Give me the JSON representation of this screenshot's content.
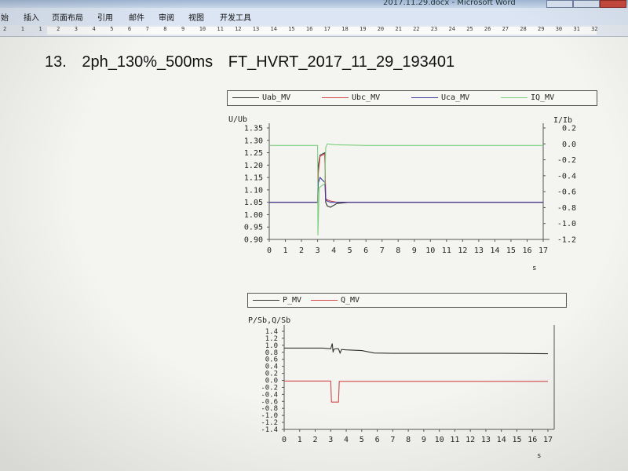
{
  "window": {
    "title": "2017.11.29.docx - Microsoft Word"
  },
  "ribbon": {
    "tabs": [
      "始",
      "插入",
      "页面布局",
      "引用",
      "邮件",
      "审阅",
      "视图",
      "开发工具"
    ]
  },
  "ruler": {
    "numbers": [
      "2",
      "1",
      "1",
      "2",
      "3",
      "4",
      "5",
      "6",
      "7",
      "8",
      "9",
      "10",
      "11",
      "12",
      "13",
      "14",
      "15",
      "16",
      "17",
      "18",
      "19",
      "20",
      "21",
      "22",
      "23",
      "24",
      "25",
      "26",
      "27",
      "28",
      "29",
      "30",
      "31",
      "32"
    ]
  },
  "document": {
    "heading": {
      "number": "13.",
      "case": "2ph_130%_500ms",
      "file": "FT_HVRT_2017_11_29_193401"
    }
  },
  "colors": {
    "uab": "#333333",
    "ubc": "#d04848",
    "uca": "#3a3aa0",
    "iq": "#7ccf7c",
    "p": "#333333",
    "q": "#d04848"
  },
  "chart_data": [
    {
      "type": "line",
      "legend": [
        "Uab_MV",
        "Ubc_MV",
        "Uca_MV",
        "IQ_MV"
      ],
      "ylabel": "U/Ub",
      "ylabel_right": "I/Ib",
      "xlabel": "s",
      "xlim": [
        0,
        17
      ],
      "ylim": [
        0.9,
        1.35
      ],
      "ylim_right": [
        -1.2,
        0.2
      ],
      "x_ticks": [
        "0",
        "1",
        "2",
        "3",
        "4",
        "5",
        "6",
        "7",
        "8",
        "9",
        "10",
        "11",
        "12",
        "13",
        "14",
        "15",
        "16",
        "17"
      ],
      "y_ticks": [
        "1.35",
        "1.30",
        "1.25",
        "1.20",
        "1.15",
        "1.10",
        "1.05",
        "1.00",
        "0.95",
        "0.90"
      ],
      "y_ticks_right": [
        "0.2",
        "0.0",
        "-0.2",
        "-0.4",
        "-0.6",
        "-0.8",
        "-1.0",
        "-1.2"
      ],
      "series": [
        {
          "name": "Uab_MV",
          "axis": "left",
          "x": [
            0,
            3.0,
            3.05,
            3.15,
            3.3,
            3.45,
            3.5,
            3.6,
            3.8,
            4.2,
            5,
            6,
            8,
            10,
            12,
            14,
            17
          ],
          "y": [
            1.05,
            1.05,
            1.2,
            1.24,
            1.245,
            1.25,
            1.05,
            1.035,
            1.03,
            1.045,
            1.05,
            1.05,
            1.05,
            1.05,
            1.05,
            1.05,
            1.05
          ]
        },
        {
          "name": "Ubc_MV",
          "axis": "left",
          "x": [
            0,
            3.0,
            3.05,
            3.15,
            3.3,
            3.45,
            3.5,
            3.6,
            3.8,
            4.2,
            5,
            6,
            8,
            10,
            12,
            14,
            17
          ],
          "y": [
            1.05,
            1.05,
            1.17,
            1.235,
            1.24,
            1.245,
            1.065,
            1.06,
            1.055,
            1.05,
            1.05,
            1.05,
            1.05,
            1.05,
            1.05,
            1.05,
            1.05
          ]
        },
        {
          "name": "Uca_MV",
          "axis": "left",
          "x": [
            0,
            3.0,
            3.05,
            3.15,
            3.3,
            3.45,
            3.5,
            3.6,
            3.8,
            4.2,
            5,
            6,
            8,
            10,
            12,
            14,
            17
          ],
          "y": [
            1.05,
            1.05,
            1.13,
            1.15,
            1.14,
            1.13,
            1.06,
            1.055,
            1.05,
            1.05,
            1.05,
            1.05,
            1.05,
            1.05,
            1.05,
            1.05,
            1.05
          ]
        },
        {
          "name": "IQ_MV",
          "axis": "right",
          "x": [
            0,
            3.0,
            3.02,
            3.1,
            3.3,
            3.45,
            3.5,
            3.6,
            4,
            6,
            8,
            10,
            12,
            14,
            17
          ],
          "y": [
            -0.02,
            -0.02,
            -1.15,
            -0.55,
            -0.52,
            -0.5,
            -0.05,
            0.0,
            -0.01,
            -0.02,
            -0.02,
            -0.02,
            -0.02,
            -0.02,
            -0.02
          ]
        }
      ]
    },
    {
      "type": "line",
      "legend": [
        "P_MV",
        "Q_MV"
      ],
      "ylabel": "P/Sb,Q/Sb",
      "xlabel": "s",
      "xlim": [
        0,
        17
      ],
      "ylim": [
        -1.4,
        1.4
      ],
      "x_ticks": [
        "0",
        "1",
        "2",
        "3",
        "4",
        "5",
        "6",
        "7",
        "8",
        "9",
        "10",
        "11",
        "12",
        "13",
        "14",
        "15",
        "16",
        "17"
      ],
      "y_ticks": [
        "1.4",
        "1.2",
        "1.0",
        "0.8",
        "0.6",
        "0.4",
        "0.2",
        "0.0",
        "-0.2",
        "-0.4",
        "-0.6",
        "-0.8",
        "-1.0",
        "-1.2",
        "-1.4"
      ],
      "series": [
        {
          "name": "P_MV",
          "x": [
            0,
            2.5,
            3.0,
            3.1,
            3.15,
            3.2,
            3.3,
            3.5,
            3.6,
            3.7,
            4,
            5,
            5.8,
            7,
            10,
            14,
            17
          ],
          "y": [
            0.92,
            0.92,
            0.9,
            1.05,
            0.8,
            0.88,
            0.9,
            0.9,
            0.78,
            0.88,
            0.87,
            0.85,
            0.78,
            0.77,
            0.77,
            0.77,
            0.76
          ]
        },
        {
          "name": "Q_MV",
          "x": [
            0,
            3.0,
            3.05,
            3.5,
            3.55,
            4,
            6,
            10,
            14,
            17
          ],
          "y": [
            -0.02,
            -0.02,
            -0.62,
            -0.62,
            -0.03,
            -0.03,
            -0.03,
            -0.03,
            -0.03,
            -0.03
          ]
        }
      ]
    }
  ]
}
